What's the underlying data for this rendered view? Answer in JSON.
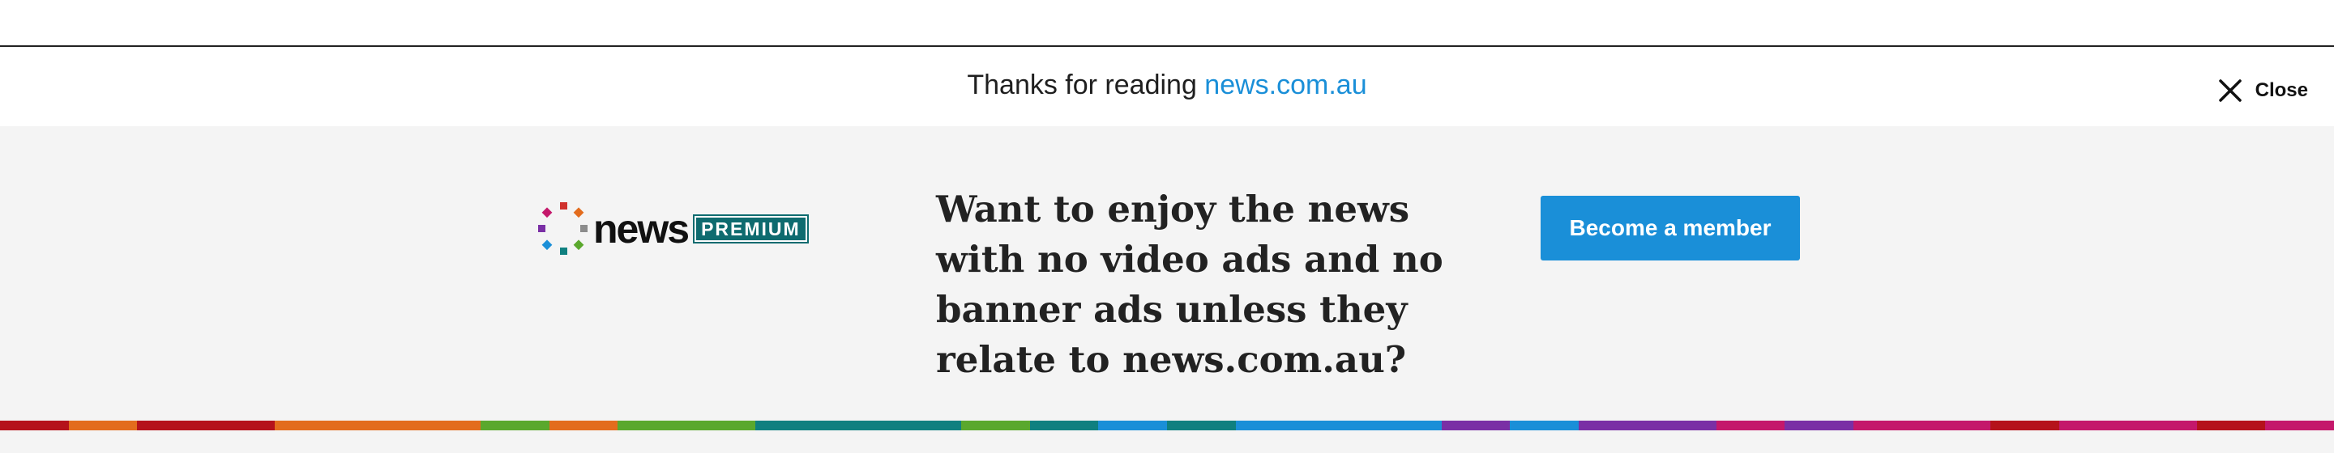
{
  "banner": {
    "thanks_prefix": "Thanks for reading ",
    "thanks_site": "news.com.au",
    "close_label": "Close",
    "close_icon": "close-x-icon"
  },
  "promo": {
    "logo": {
      "icon": "news-dots-icon",
      "word": "news",
      "badge": "PREMIUM"
    },
    "headline": "Want to enjoy the news with no video ads and no banner ads unless they relate to news.com.au?",
    "cta_label": "Become a member"
  },
  "colors": {
    "accent_blue": "#1a8fd8",
    "badge_teal": "#0e6b6f",
    "promo_bg": "#f4f4f4",
    "stripe": [
      "#b5121b",
      "#e36c1d",
      "#b5121b",
      "#b5121b",
      "#e36c1d",
      "#e36c1d",
      "#e36c1d",
      "#5aa82d",
      "#e36c1d",
      "#5aa82d",
      "#5aa82d",
      "#0f8080",
      "#0f8080",
      "#0f8080",
      "#5aa82d",
      "#0f8080",
      "#1a8fd8",
      "#0f8080",
      "#1a8fd8",
      "#1a8fd8",
      "#1a8fd8",
      "#7a2fa5",
      "#1a8fd8",
      "#7a2fa5",
      "#7a2fa5",
      "#c4186b",
      "#7a2fa5",
      "#c4186b",
      "#c4186b",
      "#b5121b",
      "#c4186b",
      "#c4186b",
      "#b5121b",
      "#c4186b"
    ]
  }
}
